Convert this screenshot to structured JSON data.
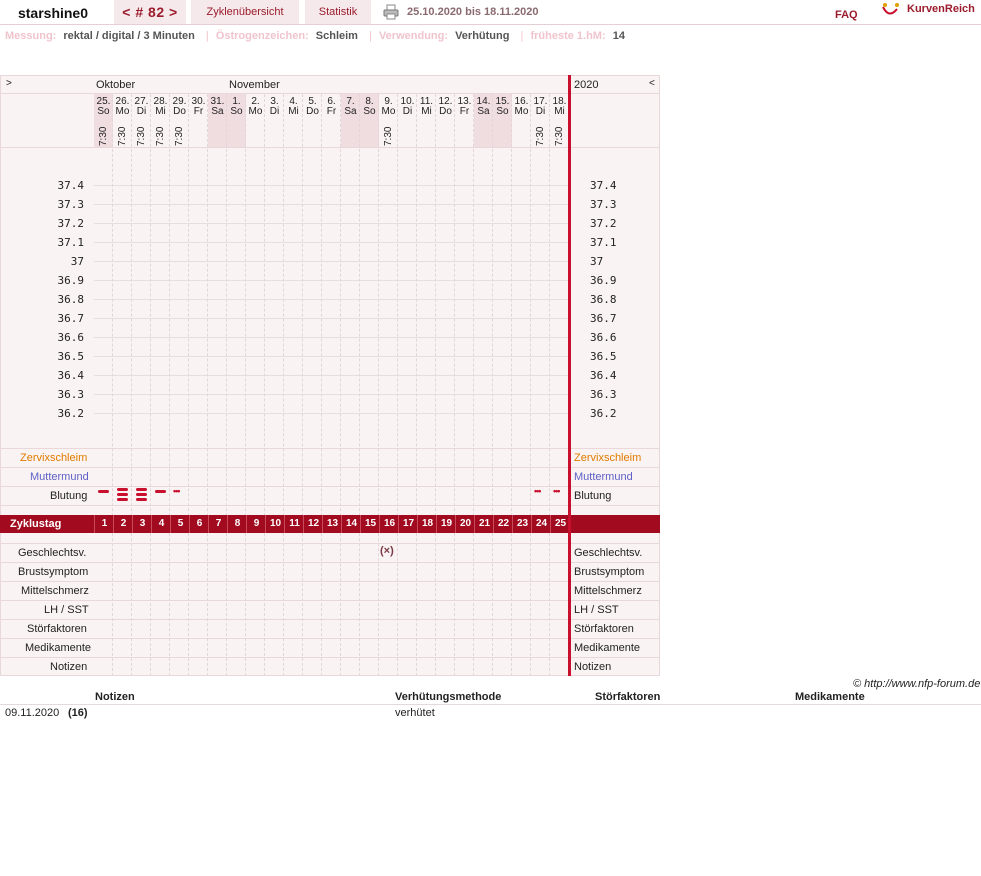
{
  "header": {
    "username": "starshine0",
    "cycle_nav": "< # 82 >",
    "cycle_overview": "Zyklenübersicht",
    "statistics": "Statistik",
    "date_range": "25.10.2020 bis 18.11.2020",
    "faq": "FAQ",
    "logo_text": "KurvenReich"
  },
  "info": {
    "measurement_label": "Messung:",
    "measurement_value": "rektal / digital / 3 Minuten",
    "estrogen_label": "Östrogenzeichen:",
    "estrogen_value": "Schleim",
    "usage_label": "Verwendung:",
    "usage_value": "Verhütung",
    "earliest_label": "früheste 1.hM:",
    "earliest_value": "14"
  },
  "chart": {
    "nav_prev": ">",
    "nav_next": "<",
    "year": "2020",
    "month_oct": "Oktober",
    "month_nov": "November",
    "days": [
      {
        "num": "25.",
        "name": "So",
        "time": "7:30",
        "weekend": true
      },
      {
        "num": "26.",
        "name": "Mo",
        "time": "7:30",
        "weekend": false
      },
      {
        "num": "27.",
        "name": "Di",
        "time": "7:30",
        "weekend": false
      },
      {
        "num": "28.",
        "name": "Mi",
        "time": "7:30",
        "weekend": false
      },
      {
        "num": "29.",
        "name": "Do",
        "time": "7:30",
        "weekend": false
      },
      {
        "num": "30.",
        "name": "Fr",
        "time": "",
        "weekend": false
      },
      {
        "num": "31.",
        "name": "Sa",
        "time": "",
        "weekend": true
      },
      {
        "num": "1.",
        "name": "So",
        "time": "",
        "weekend": true
      },
      {
        "num": "2.",
        "name": "Mo",
        "time": "",
        "weekend": false
      },
      {
        "num": "3.",
        "name": "Di",
        "time": "",
        "weekend": false
      },
      {
        "num": "4.",
        "name": "Mi",
        "time": "",
        "weekend": false
      },
      {
        "num": "5.",
        "name": "Do",
        "time": "",
        "weekend": false
      },
      {
        "num": "6.",
        "name": "Fr",
        "time": "",
        "weekend": false
      },
      {
        "num": "7.",
        "name": "Sa",
        "time": "",
        "weekend": true
      },
      {
        "num": "8.",
        "name": "So",
        "time": "",
        "weekend": true
      },
      {
        "num": "9.",
        "name": "Mo",
        "time": "7:30",
        "weekend": false
      },
      {
        "num": "10.",
        "name": "Di",
        "time": "",
        "weekend": false
      },
      {
        "num": "11.",
        "name": "Mi",
        "time": "",
        "weekend": false
      },
      {
        "num": "12.",
        "name": "Do",
        "time": "",
        "weekend": false
      },
      {
        "num": "13.",
        "name": "Fr",
        "time": "",
        "weekend": false
      },
      {
        "num": "14.",
        "name": "Sa",
        "time": "",
        "weekend": true
      },
      {
        "num": "15.",
        "name": "So",
        "time": "",
        "weekend": true
      },
      {
        "num": "16.",
        "name": "Mo",
        "time": "",
        "weekend": false
      },
      {
        "num": "17.",
        "name": "Di",
        "time": "7:30",
        "weekend": false
      },
      {
        "num": "18.",
        "name": "Mi",
        "time": "7:30",
        "weekend": false
      }
    ],
    "temps": [
      "37.4",
      "37.3",
      "37.2",
      "37.1",
      "37",
      "36.9",
      "36.8",
      "36.7",
      "36.6",
      "36.5",
      "36.4",
      "36.3",
      "36.2"
    ],
    "rows": {
      "cervical_mucus": "Zervixschleim",
      "cervix": "Muttermund",
      "bleeding": "Blutung",
      "cycle_day": "Zyklustag",
      "intercourse": "Geschlechtsv.",
      "breast": "Brustsymptom",
      "midpain": "Mittelschmerz",
      "lh": "LH / SST",
      "disturbances": "Störfaktoren",
      "medication": "Medikamente",
      "notes": "Notizen"
    },
    "bleeding": [
      "medium",
      "heavy",
      "heavy",
      "medium",
      "spotting",
      "",
      "",
      "",
      "",
      "",
      "",
      "",
      "",
      "",
      "",
      "",
      "",
      "",
      "",
      "",
      "",
      "",
      "",
      "spotting",
      "spotting"
    ],
    "intercourse_mark": "(×)",
    "intercourse_day_index": 15,
    "cycle_days": [
      "1",
      "2",
      "3",
      "4",
      "5",
      "6",
      "7",
      "8",
      "9",
      "10",
      "11",
      "12",
      "13",
      "14",
      "15",
      "16",
      "17",
      "18",
      "19",
      "20",
      "21",
      "22",
      "23",
      "24",
      "25"
    ],
    "colors": {
      "mucus": "#e07b00",
      "cervix": "#5b5fc7",
      "accent": "#a10a1f",
      "bar": "#c8102e"
    }
  },
  "footer": {
    "copyright": "© http://www.nfp-forum.de",
    "col_notes": "Notizen",
    "col_method": "Verhütungsmethode",
    "col_disturb": "Störfaktoren",
    "col_meds": "Medikamente",
    "row_date": "09.11.2020",
    "row_day": "(16)",
    "row_method": "verhütet"
  }
}
